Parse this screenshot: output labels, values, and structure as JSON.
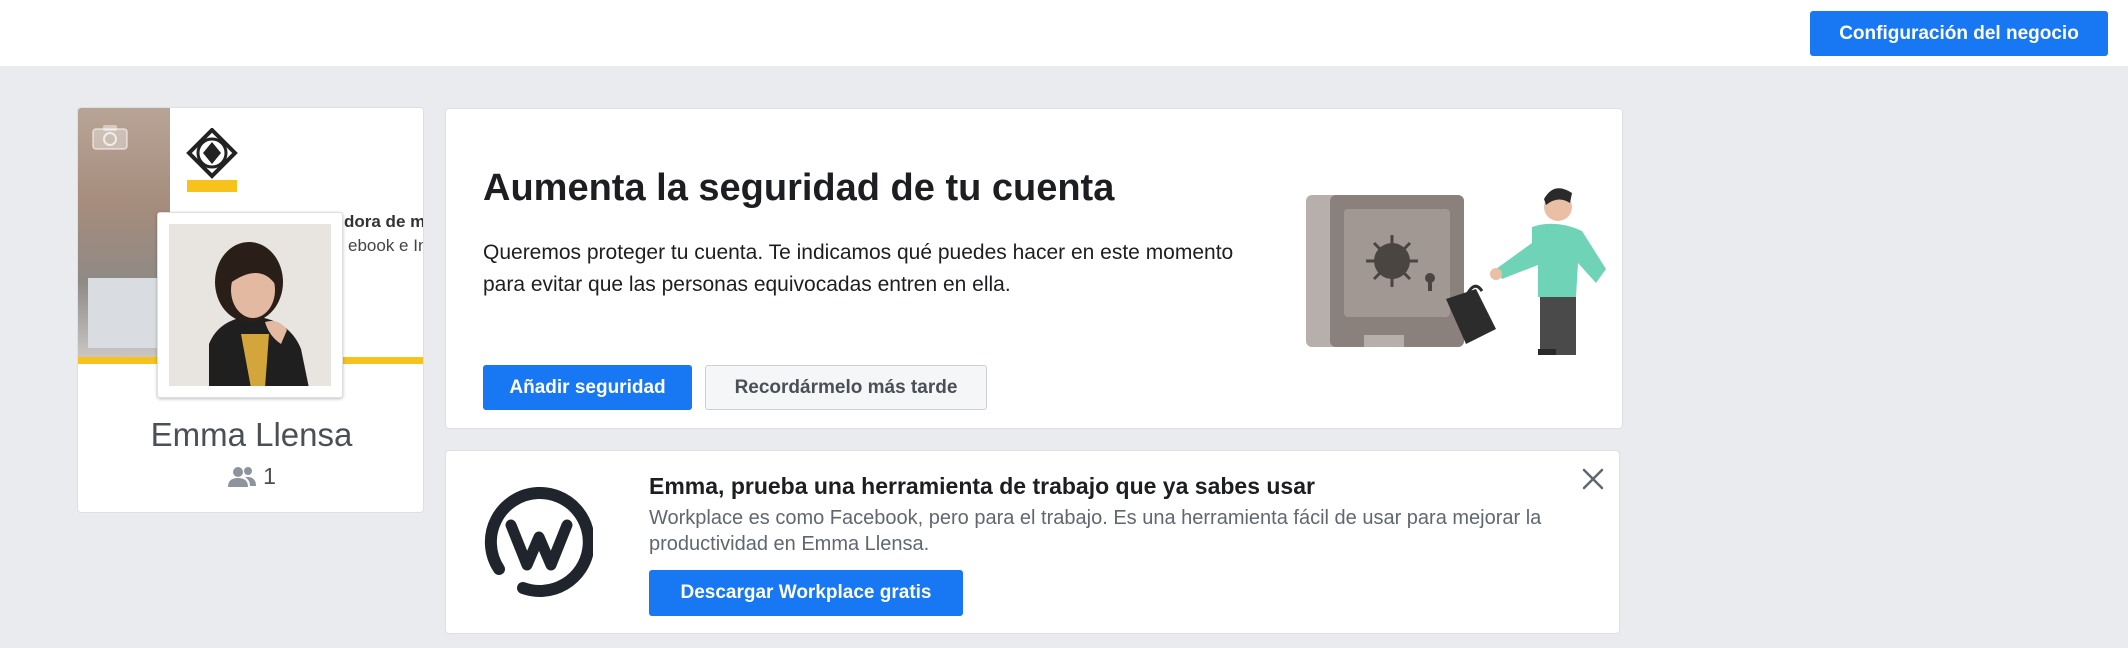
{
  "topbar": {
    "business_settings_label": "Configuración del negocio"
  },
  "profile": {
    "name": "Emma Llensa",
    "member_count": "1",
    "cover_text_line1": "dora de m",
    "cover_text_line2": "ebook e In",
    "brand_logo_text": "Emma Llensa"
  },
  "security": {
    "title": "Aumenta la seguridad de tu cuenta",
    "description": "Queremos proteger tu cuenta. Te indicamos qué puedes hacer en este momento para evitar que las personas equivocadas entren en ella.",
    "add_button": "Añadir seguridad",
    "later_button": "Recordármelo más tarde"
  },
  "workplace": {
    "title": "Emma, prueba una herramienta de trabajo que ya sabes usar",
    "description": "Workplace es como Facebook, pero para el trabajo. Es una herramienta fácil de usar para mejorar la productividad en Emma Llensa.",
    "button": "Descargar Workplace gratis"
  },
  "colors": {
    "accent": "#1877f2",
    "background": "#e9ebee",
    "cover_yellow": "#f6c21b",
    "illustration_teal": "#6fd3b8"
  },
  "icons": [
    "camera-icon",
    "members-icon",
    "close-icon",
    "workplace-logo-icon",
    "safe-illustration"
  ]
}
